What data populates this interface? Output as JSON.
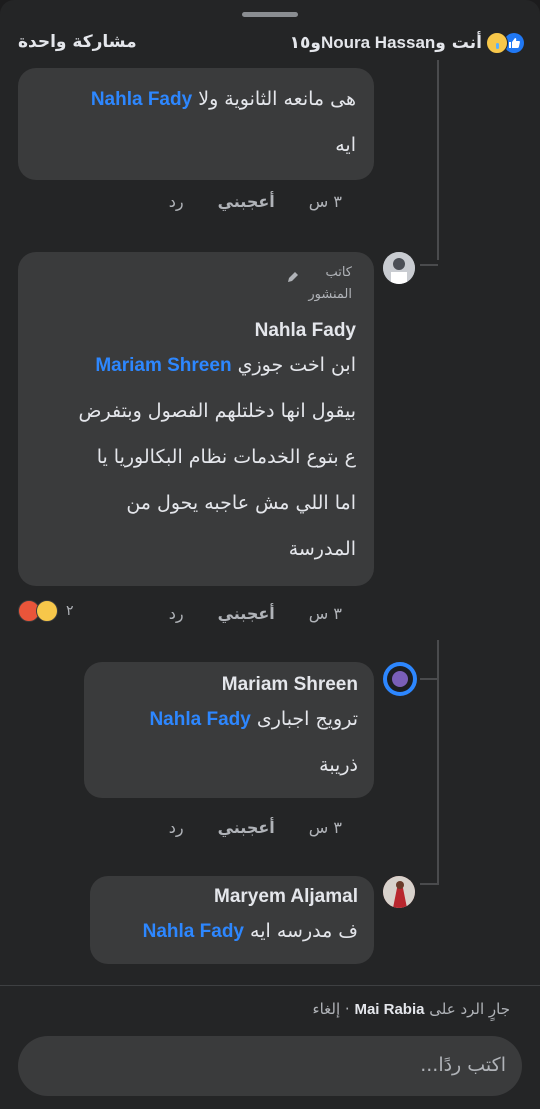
{
  "header": {
    "share_label": "مشاركة واحدة",
    "reactors_text": "أنت و",
    "reactors_name": "Noura Hassan",
    "reactors_rest": " و١٥"
  },
  "comments": [
    {
      "line1_prefix": "هى مانعه الثانوية ولا ",
      "line1_mention": "Nahla Fady",
      "line2": "ايه",
      "time": "٣ س",
      "like": "أعجبني",
      "reply": "رد"
    },
    {
      "badge_line1": "كاتب",
      "badge_line2": "المنشور",
      "name": "Nahla Fady",
      "line1_prefix": "ابن اخت جوزي ",
      "line1_mention": "Mariam Shreen",
      "line2": "بيقول انها دخلتلهم الفصول وبتفرض",
      "line3": "ع بتوع الخدمات نظام البكالوريا يا",
      "line4": "اما اللي مش عاجبه يحول من",
      "line5": "المدرسة",
      "time": "٣ س",
      "like": "أعجبني",
      "reply": "رد",
      "react_count": "٢"
    },
    {
      "name": "Mariam Shreen",
      "line1_prefix": "ترويج اجبارى ",
      "line1_mention": "Nahla Fady",
      "line2": "ذريبة",
      "time": "٣ س",
      "like": "أعجبني",
      "reply": "رد"
    },
    {
      "name": "Maryem Aljamal",
      "line1_prefix": "ف مدرسه ايه ",
      "line1_mention": "Nahla Fady"
    }
  ],
  "footer": {
    "replying_prefix": "جارٍ الرد على ",
    "replying_name": "Mai Rabia",
    "cancel": " · إلغاء",
    "placeholder": "اكتب ردًا..."
  },
  "colors": {
    "mention": "#2d87ff",
    "background": "#242526",
    "bubble": "#3a3b3c"
  }
}
